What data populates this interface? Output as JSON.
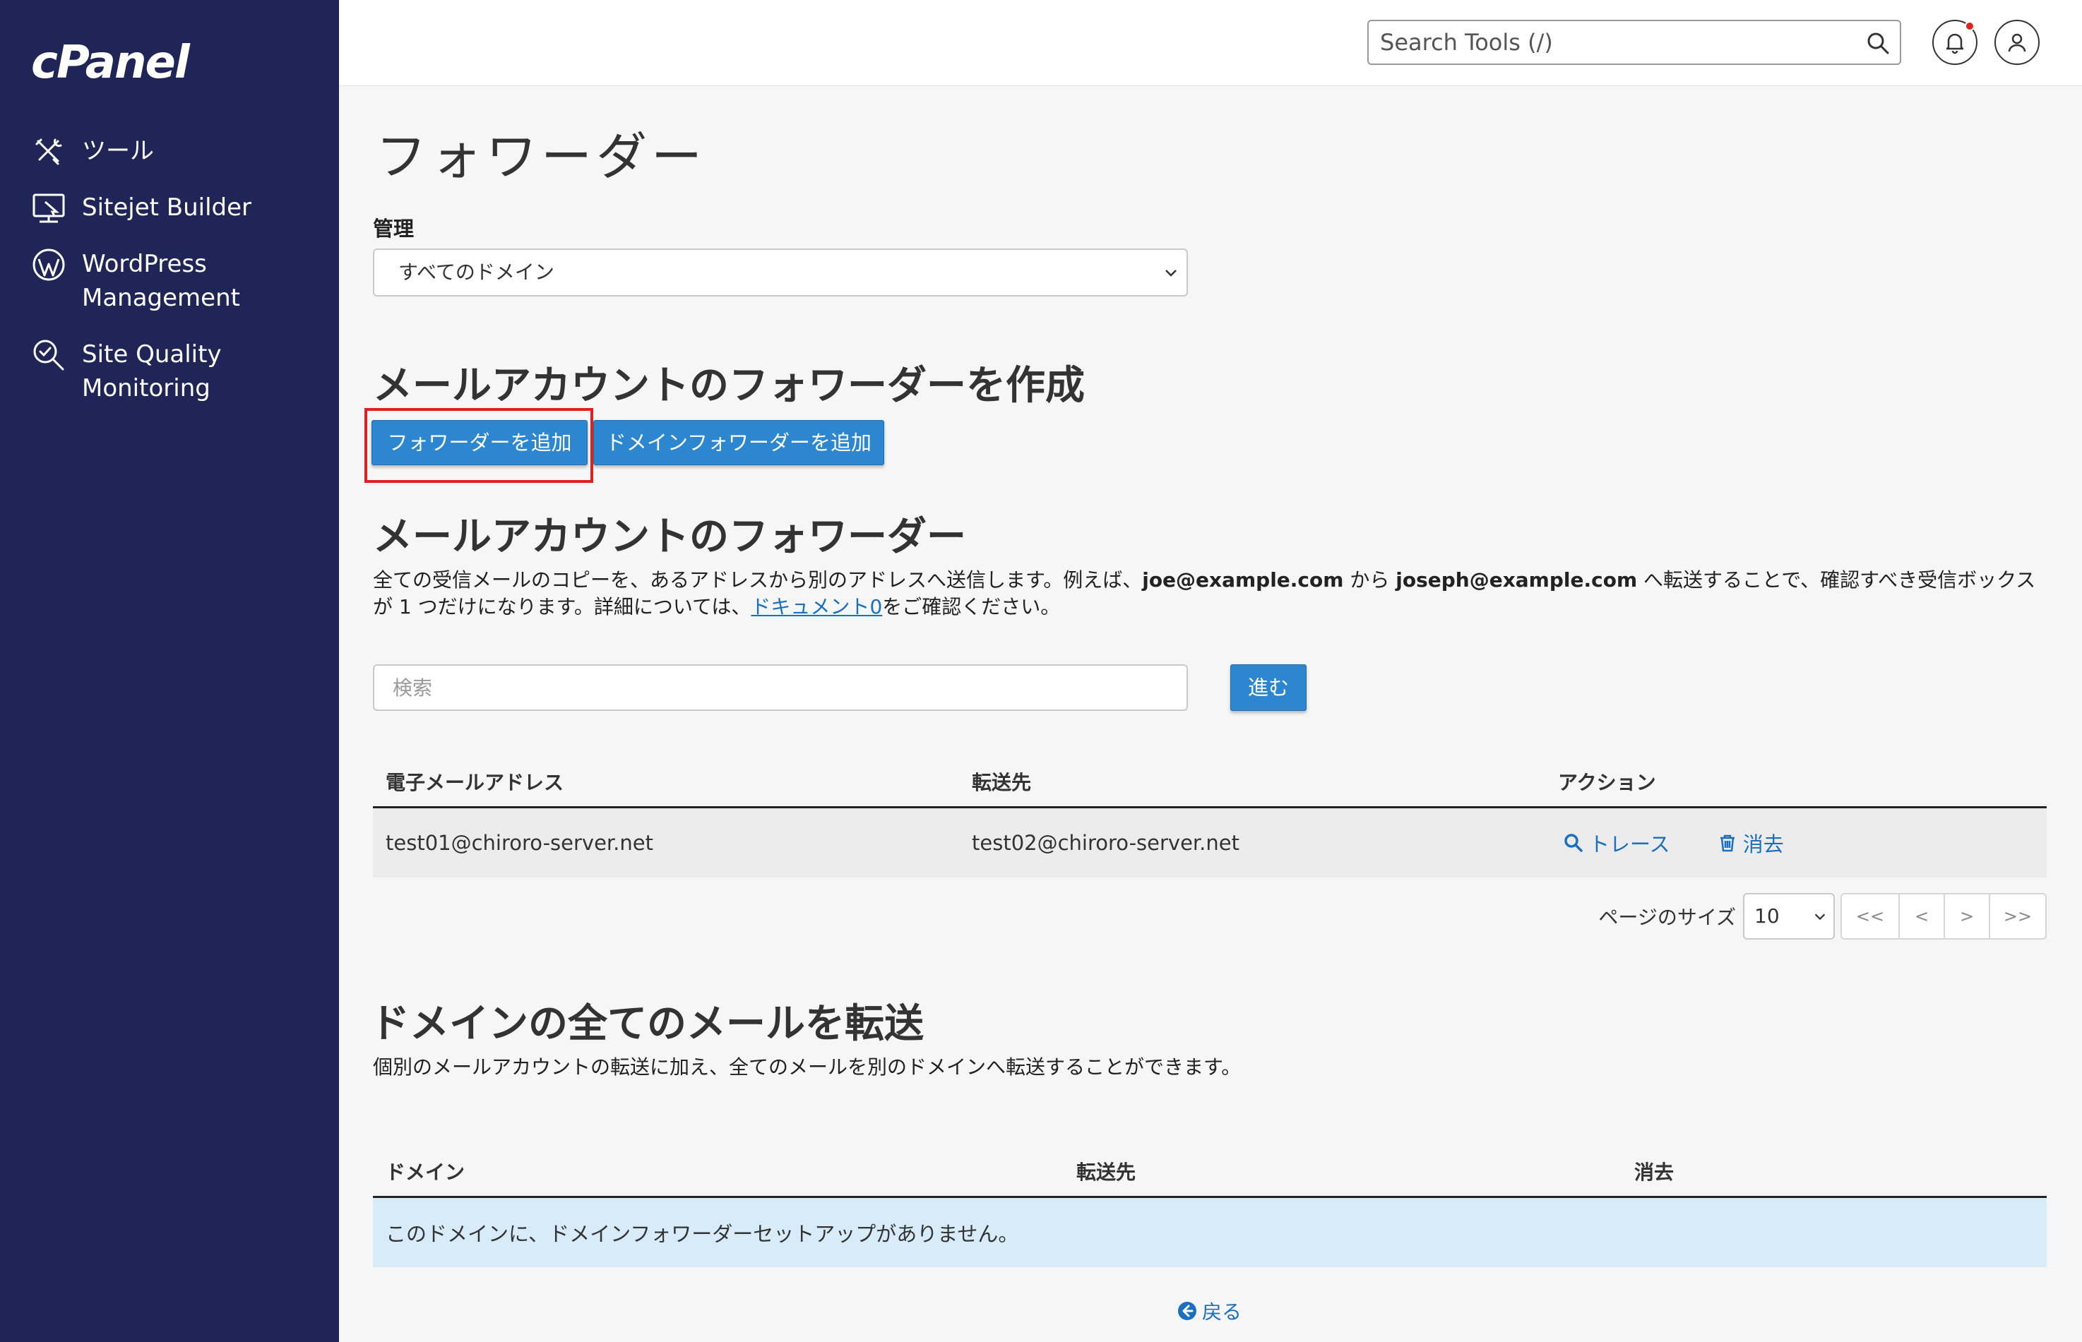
{
  "sidebar": {
    "logo": "cPanel",
    "items": [
      {
        "label": "ツール",
        "icon": "tools-icon"
      },
      {
        "label": "Sitejet Builder",
        "icon": "sitejet-icon"
      },
      {
        "label": "WordPress\nManagement",
        "icon": "wordpress-icon"
      },
      {
        "label": "Site Quality\nMonitoring",
        "icon": "site-quality-icon"
      }
    ]
  },
  "header": {
    "search_placeholder": "Search Tools (/)"
  },
  "main": {
    "page_title": "フォワーダー",
    "manage_label": "管理",
    "domain_select_value": "すべてのドメイン",
    "create_heading": "メールアカウントのフォワーダーを作成",
    "add_forwarder_label": "フォワーダーを追加",
    "add_domain_forwarder_label": "ドメインフォワーダーを追加",
    "account_heading": "メールアカウントのフォワーダー",
    "description": {
      "part1": "全ての受信メールのコピーを、あるアドレスから別のアドレスへ送信します。例えば、",
      "example_from": "joe@example.com",
      "part2": " から ",
      "example_to": "joseph@example.com",
      "part3": " へ転送することで、確認すべき受信ボックスが 1 つだけになります。詳細については、",
      "doc_link": "ドキュメント",
      "doc_link_suffix": "0",
      "part4": "をご確認ください。"
    },
    "filter_placeholder": "検索",
    "go_label": "進む",
    "table": {
      "headers": [
        "電子メールアドレス",
        "転送先",
        "アクション"
      ],
      "rows": [
        {
          "email": "test01@chiroro-server.net",
          "forward_to": "test02@chiroro-server.net"
        }
      ],
      "trace_label": "トレース",
      "delete_label": "消去"
    },
    "pager": {
      "label": "ページのサイズ",
      "size": "10",
      "first": "<<",
      "prev": "<",
      "next": ">",
      "last": ">>"
    },
    "domain_heading": "ドメインの全てのメールを転送",
    "domain_description": "個別のメールアカウントの転送に加え、全てのメールを別のドメインへ転送することができます。",
    "domain_table": {
      "headers": [
        "ドメイン",
        "転送先",
        "消去"
      ],
      "empty_message": "このドメインに、ドメインフォワーダーセットアップがありません。"
    },
    "back_label": "戻る"
  }
}
